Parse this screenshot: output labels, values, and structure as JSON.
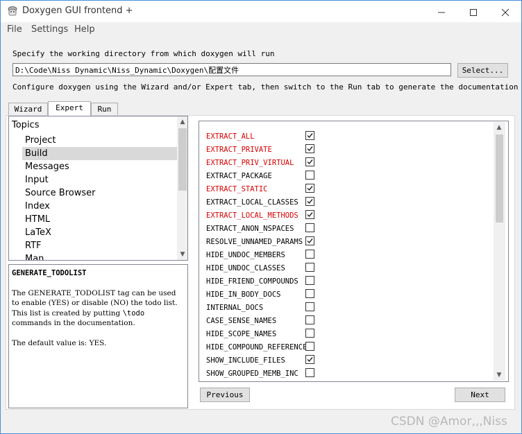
{
  "window": {
    "title": "Doxygen GUI frontend +",
    "minimize_icon": "minimize-icon",
    "maximize_icon": "maximize-icon",
    "close_icon": "close-icon"
  },
  "menu": [
    "File",
    "Settings",
    "Help"
  ],
  "workdir": {
    "prompt": "Specify the working directory from which doxygen will run",
    "value": "D:\\Code\\Niss Dynamic\\Niss_Dynamic\\Doxygen\\配置文件",
    "select_label": "Select..."
  },
  "instructions": "Configure doxygen using the Wizard and/or Expert tab, then switch to the Run tab to generate the documentation",
  "tabs": [
    {
      "label": "Wizard",
      "active": false
    },
    {
      "label": "Expert",
      "active": true
    },
    {
      "label": "Run",
      "active": false
    }
  ],
  "topics": {
    "header": "Topics",
    "items": [
      "Project",
      "Build",
      "Messages",
      "Input",
      "Source Browser",
      "Index",
      "HTML",
      "LaTeX",
      "RTF",
      "Man"
    ],
    "selected": "Build"
  },
  "help": {
    "title": "GENERATE_TODOLIST",
    "p1_a": "The GENERATE_TODOLIST tag can be used to enable (YES) or disable (NO) the todo list. This list is created by putting ",
    "p1_code": "\\todo",
    "p1_b": " commands in the documentation.",
    "p2": "The default value is: YES."
  },
  "options": [
    {
      "name": "EXTRACT_ALL",
      "checked": true,
      "modified": true
    },
    {
      "name": "EXTRACT_PRIVATE",
      "checked": true,
      "modified": true
    },
    {
      "name": "EXTRACT_PRIV_VIRTUAL",
      "checked": true,
      "modified": true
    },
    {
      "name": "EXTRACT_PACKAGE",
      "checked": false,
      "modified": false
    },
    {
      "name": "EXTRACT_STATIC",
      "checked": true,
      "modified": true
    },
    {
      "name": "EXTRACT_LOCAL_CLASSES",
      "checked": true,
      "modified": false
    },
    {
      "name": "EXTRACT_LOCAL_METHODS",
      "checked": true,
      "modified": true
    },
    {
      "name": "EXTRACT_ANON_NSPACES",
      "checked": false,
      "modified": false
    },
    {
      "name": "RESOLVE_UNNAMED_PARAMS",
      "checked": true,
      "modified": false
    },
    {
      "name": "HIDE_UNDOC_MEMBERS",
      "checked": false,
      "modified": false
    },
    {
      "name": "HIDE_UNDOC_CLASSES",
      "checked": false,
      "modified": false
    },
    {
      "name": "HIDE_FRIEND_COMPOUNDS",
      "checked": false,
      "modified": false
    },
    {
      "name": "HIDE_IN_BODY_DOCS",
      "checked": false,
      "modified": false
    },
    {
      "name": "INTERNAL_DOCS",
      "checked": false,
      "modified": false
    },
    {
      "name": "CASE_SENSE_NAMES",
      "checked": false,
      "modified": false
    },
    {
      "name": "HIDE_SCOPE_NAMES",
      "checked": false,
      "modified": false
    },
    {
      "name": "HIDE_COMPOUND_REFERENCE",
      "checked": false,
      "modified": false
    },
    {
      "name": "SHOW_INCLUDE_FILES",
      "checked": true,
      "modified": false
    },
    {
      "name": "SHOW_GROUPED_MEMB_INC",
      "checked": false,
      "modified": false
    }
  ],
  "nav": {
    "previous": "Previous",
    "next": "Next"
  },
  "watermark": "CSDN @Amor,,,Niss",
  "colors": {
    "modified_option": "#d60000",
    "selection": "#d9d9d9"
  }
}
